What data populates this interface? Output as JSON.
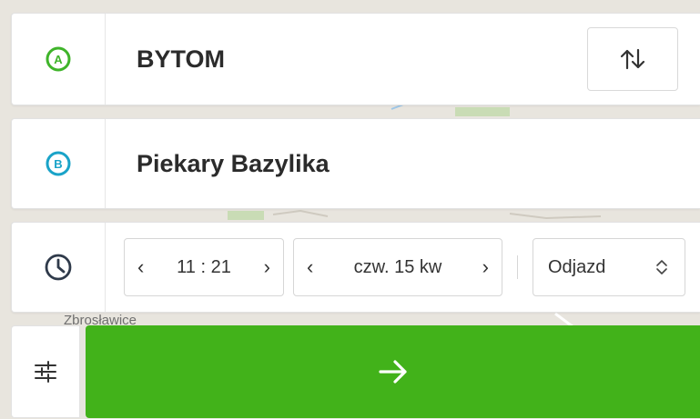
{
  "map": {
    "place_label": "Zbrosławice"
  },
  "origin": {
    "marker": "A",
    "value": "BYTOM",
    "icon": "marker-a-icon",
    "color": "#3fb42a"
  },
  "destination": {
    "marker": "B",
    "value": "Piekary Bazylika",
    "icon": "marker-b-icon",
    "color": "#1aa3c8"
  },
  "swap": {
    "icon": "swap-arrows-icon"
  },
  "schedule": {
    "icon": "clock-icon",
    "time": {
      "prev": "‹",
      "value": "11 : 21",
      "next": "›"
    },
    "date": {
      "prev": "‹",
      "value": "czw. 15 kw",
      "next": "›"
    },
    "mode": {
      "value": "Odjazd",
      "icon": "select-chevrons-icon"
    }
  },
  "actions": {
    "filters_icon": "sliders-icon",
    "search_icon": "arrow-right-icon",
    "search_color": "#42b21a"
  }
}
